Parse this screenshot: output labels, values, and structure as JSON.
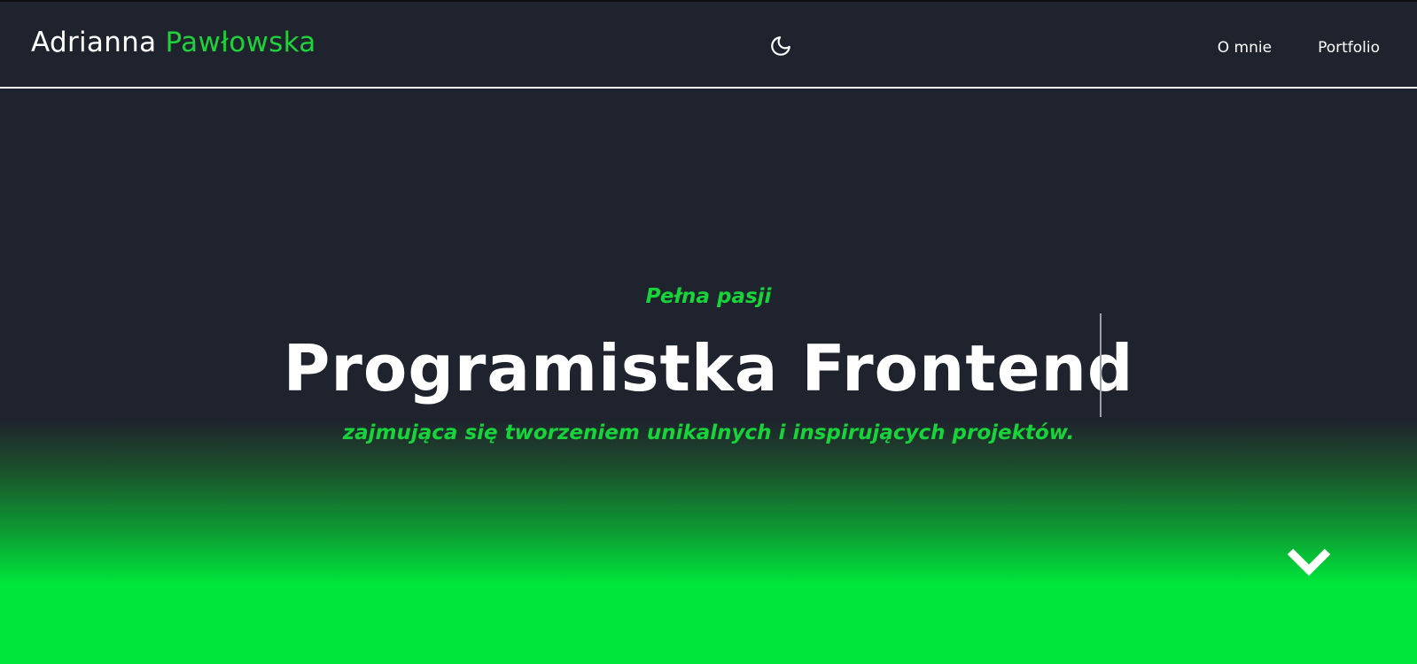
{
  "header": {
    "logo_first": "Adrianna",
    "logo_second": "Pawłowska",
    "theme_toggle_icon": "moon-icon",
    "nav": [
      {
        "label": "O mnie"
      },
      {
        "label": "Portfolio"
      }
    ]
  },
  "hero": {
    "kicker": "Pełna pasji",
    "headline": "Programistka Frontend",
    "tagline": "zajmująca się tworzeniem unikalnych i inspirujących projektów.",
    "scroll_icon": "chevron-down-icon"
  },
  "colors": {
    "background": "#1f232d",
    "accent": "#1fd13a",
    "gradient_bottom": "#00e63b",
    "text": "#ffffff"
  }
}
